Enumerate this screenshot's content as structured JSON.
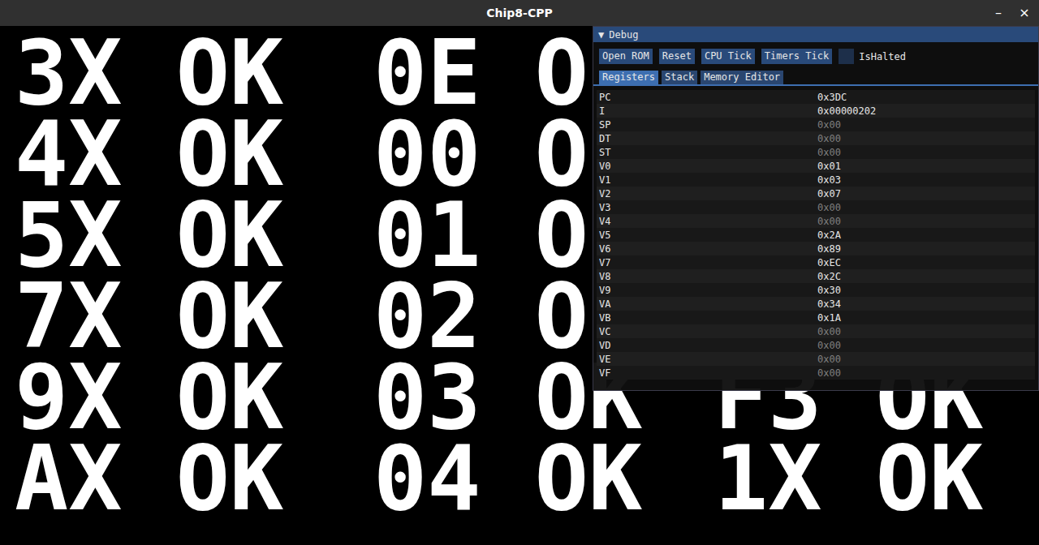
{
  "window": {
    "title": "Chip8-CPP",
    "controls": [
      "–",
      "×"
    ]
  },
  "display": {
    "rows": [
      [
        "3X OK",
        "0E O"
      ],
      [
        "4X OK",
        "00 O"
      ],
      [
        "5X OK",
        "01 O"
      ],
      [
        "7X OK",
        "02 O"
      ],
      [
        "9X OK",
        "03 OK",
        "F3 OK"
      ],
      [
        "AX OK",
        "04 OK",
        "1X OK"
      ]
    ]
  },
  "debug": {
    "toggle": "▼",
    "title": "Debug",
    "buttons": [
      "Open ROM",
      "Reset",
      "CPU Tick",
      "Timers Tick"
    ],
    "halted": {
      "label": "IsHalted",
      "checked": false
    },
    "tabs": [
      {
        "label": "Registers",
        "selected": true
      },
      {
        "label": "Stack",
        "selected": false
      },
      {
        "label": "Memory Editor",
        "selected": false
      }
    ],
    "registers": [
      {
        "name": "PC",
        "value": "0x3DC",
        "dimmed": false
      },
      {
        "name": "I",
        "value": "0x00000202",
        "dimmed": false
      },
      {
        "name": "SP",
        "value": "0x00",
        "dimmed": true
      },
      {
        "name": "DT",
        "value": "0x00",
        "dimmed": true
      },
      {
        "name": "ST",
        "value": "0x00",
        "dimmed": true
      },
      {
        "name": "V0",
        "value": "0x01",
        "dimmed": false
      },
      {
        "name": "V1",
        "value": "0x03",
        "dimmed": false
      },
      {
        "name": "V2",
        "value": "0x07",
        "dimmed": false
      },
      {
        "name": "V3",
        "value": "0x00",
        "dimmed": true
      },
      {
        "name": "V4",
        "value": "0x00",
        "dimmed": true
      },
      {
        "name": "V5",
        "value": "0x2A",
        "dimmed": false
      },
      {
        "name": "V6",
        "value": "0x89",
        "dimmed": false
      },
      {
        "name": "V7",
        "value": "0xEC",
        "dimmed": false
      },
      {
        "name": "V8",
        "value": "0x2C",
        "dimmed": false
      },
      {
        "name": "V9",
        "value": "0x30",
        "dimmed": false
      },
      {
        "name": "VA",
        "value": "0x34",
        "dimmed": false
      },
      {
        "name": "VB",
        "value": "0x1A",
        "dimmed": false
      },
      {
        "name": "VC",
        "value": "0x00",
        "dimmed": true
      },
      {
        "name": "VD",
        "value": "0x00",
        "dimmed": true
      },
      {
        "name": "VE",
        "value": "0x00",
        "dimmed": true
      },
      {
        "name": "VF",
        "value": "0x00",
        "dimmed": true
      }
    ]
  }
}
